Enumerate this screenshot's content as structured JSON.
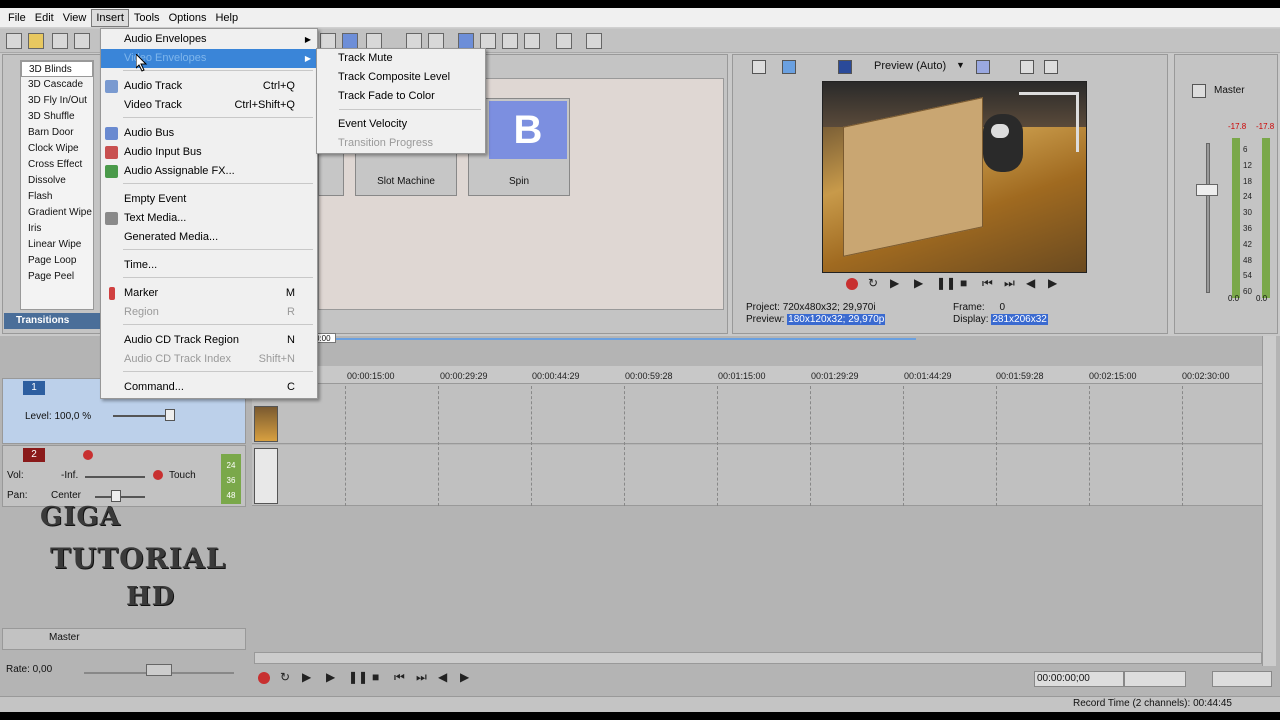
{
  "menubar": {
    "items": [
      "File",
      "Edit",
      "View",
      "Insert",
      "Tools",
      "Options",
      "Help"
    ]
  },
  "transitions": {
    "list": [
      "3D Blinds",
      "3D Cascade",
      "3D Fly In/Out",
      "3D Shuffle",
      "Barn Door",
      "Clock Wipe",
      "Cross Effect",
      "Dissolve",
      "Flash",
      "Gradient Wipe",
      "Iris",
      "Linear Wipe",
      "Page Loop",
      "Page Peel"
    ],
    "tab_label": "Transitions",
    "thumbs": [
      {
        "label": "Slot Machine"
      },
      {
        "label": "Spin",
        "glyph": "B"
      }
    ]
  },
  "insert_menu": {
    "items": [
      {
        "label": "Audio Envelopes",
        "shortcut": "",
        "submenu": true,
        "disabled": false
      },
      {
        "label": "Video Envelopes",
        "shortcut": "",
        "submenu": true,
        "disabled": false
      },
      {
        "label": "Audio Track",
        "shortcut": "Ctrl+Q",
        "disabled": false
      },
      {
        "label": "Video Track",
        "shortcut": "Ctrl+Shift+Q",
        "disabled": false
      },
      {
        "label": "Audio Bus",
        "shortcut": "",
        "disabled": false
      },
      {
        "label": "Audio Input Bus",
        "shortcut": "",
        "disabled": false
      },
      {
        "label": "Audio Assignable FX...",
        "shortcut": "",
        "disabled": false
      },
      {
        "label": "Empty Event",
        "shortcut": "",
        "disabled": false
      },
      {
        "label": "Text Media...",
        "shortcut": "",
        "disabled": false
      },
      {
        "label": "Generated Media...",
        "shortcut": "",
        "disabled": false
      },
      {
        "label": "Time...",
        "shortcut": "",
        "disabled": false
      },
      {
        "label": "Marker",
        "shortcut": "M",
        "disabled": false
      },
      {
        "label": "Region",
        "shortcut": "R",
        "disabled": true
      },
      {
        "label": "Audio CD Track Region",
        "shortcut": "N",
        "disabled": false
      },
      {
        "label": "Audio CD Track Index",
        "shortcut": "Shift+N",
        "disabled": true
      },
      {
        "label": "Command...",
        "shortcut": "C",
        "disabled": false
      }
    ]
  },
  "video_envelopes_menu": {
    "items": [
      {
        "label": "Track Mute",
        "disabled": false
      },
      {
        "label": "Track Composite Level",
        "disabled": false
      },
      {
        "label": "Track Fade to Color",
        "disabled": false
      },
      {
        "label": "Event Velocity",
        "disabled": false
      },
      {
        "label": "Transition Progress",
        "disabled": true
      }
    ]
  },
  "preview": {
    "mode": "Preview (Auto)",
    "project_label": "Project:",
    "project_value": "720x480x32; 29,970i",
    "preview_label": "Preview:",
    "preview_value": "180x120x32; 29,970p",
    "frame_label": "Frame:",
    "frame_value": "0",
    "display_label": "Display:",
    "display_value": "281x206x32"
  },
  "master_meter": {
    "title": "Master",
    "peak_left": "-17.8",
    "peak_right": "-17.8",
    "scale": [
      "6",
      "12",
      "18",
      "24",
      "30",
      "36",
      "42",
      "48",
      "54",
      "60"
    ],
    "bottom_left": "0.0",
    "bottom_right": "0.0"
  },
  "tracks": {
    "video": {
      "number": "1",
      "level": "Level: 100,0 %"
    },
    "audio": {
      "number": "2",
      "vol_label": "Vol:",
      "vol_value": "-Inf.",
      "touch": "Touch",
      "pan_label": "Pan:",
      "pan_value": "Center"
    },
    "master": {
      "label": "Master"
    },
    "meter_marks": [
      "24",
      "36",
      "48"
    ]
  },
  "timeline": {
    "cursor": "0:00",
    "ticks": [
      "00:00:15:00",
      "00:00:29:29",
      "00:00:44:29",
      "00:00:59:28",
      "00:01:15:00",
      "00:01:29:29",
      "00:01:44:29",
      "00:01:59:28",
      "00:02:15:00",
      "00:02:30:00"
    ],
    "time_display": "00:00:00;00",
    "rate": "Rate: 0,00"
  },
  "watermark": {
    "line1": "GIGA",
    "line2": "TUTORIAL",
    "line3": "HD"
  },
  "status": {
    "record_time": "Record Time (2 channels): 00:44:45"
  },
  "colors": {
    "menu_highlight": "#3a85d8",
    "transitions_tab": "#4a6e99",
    "video_track": "#2d5ea0",
    "audio_track": "#8a1a1a"
  }
}
